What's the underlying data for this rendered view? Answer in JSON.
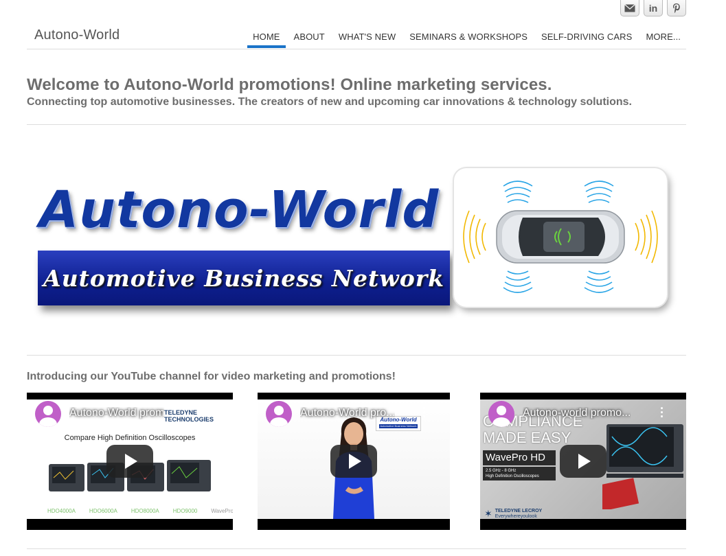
{
  "site": {
    "title": "Autono-World"
  },
  "social": [
    {
      "name": "email-icon",
      "glyph": "✉"
    },
    {
      "name": "linkedin-icon",
      "glyph": "in"
    },
    {
      "name": "pinterest-icon",
      "glyph": "P"
    }
  ],
  "nav": {
    "home": "HOME",
    "about": "ABOUT",
    "whats_new": "WHAT'S NEW",
    "seminars": "SEMINARS & WORKSHOPS",
    "self_driving": "SELF-DRIVING CARS",
    "more": "MORE..."
  },
  "headline": {
    "title": "Welcome to Autono-World promotions! Online marketing services.",
    "subtitle": "Connecting top automotive businesses. The creators of new and upcoming car innovations & technology solutions."
  },
  "banner": {
    "brand": "Autono-World",
    "tagline": "Automotive Business Network"
  },
  "youtube": {
    "heading": "Introducing our YouTube channel for video marketing and promotions!",
    "videos": [
      {
        "title": "Autono-World prom",
        "caption": "Compare High Definition Oscilloscopes",
        "vendor": "TELEDYNE TECHNOLOGIES",
        "models": [
          "HDO4000A",
          "HDO6000A",
          "HDO8000A",
          "HDO9000",
          "WavePro HD"
        ]
      },
      {
        "title": "Autono-World pro...",
        "logo_brand": "Autono-World",
        "logo_tagline": "Automotive Business Network"
      },
      {
        "title": "Autono-world promo...",
        "tagline": "COMPLIANCE MADE EASY",
        "product": "WavePro HD",
        "spec": "2.5 GHz - 8 GHz",
        "spec2": "High Definition Oscilloscopes",
        "vendor": "TELEDYNE LECROY",
        "vendor_tagline": "Everywhereyoulook"
      }
    ]
  },
  "colors": {
    "accent": "#1a73c8",
    "brand_blue": "#1238a0",
    "text_gray": "#6d6d6d",
    "youtube_avatar": "#c05fc8"
  }
}
